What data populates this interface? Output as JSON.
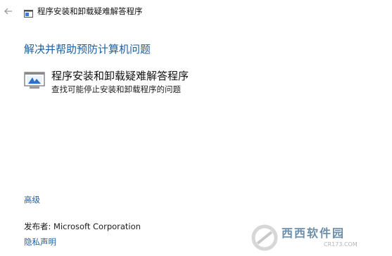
{
  "window": {
    "title": "程序安装和卸载疑难解答程序"
  },
  "main": {
    "heading": "解决并帮助预防计算机问题",
    "item": {
      "title": "程序安装和卸载疑难解答程序",
      "description": "查找可能停止安装和卸载程序的问题",
      "icon": "computer-troubleshooter-icon"
    }
  },
  "footer": {
    "advanced_label": "高级",
    "publisher_label": "发布者:  Microsoft Corporation",
    "privacy_label": "隐私声明"
  },
  "watermark": {
    "brand": "西西软件园",
    "url": "CR173.COM"
  },
  "colors": {
    "link": "#1c5e9e",
    "text": "#1a1a1a",
    "background": "#ffffff"
  }
}
